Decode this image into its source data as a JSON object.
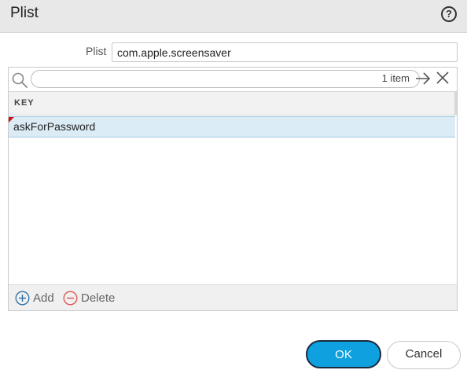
{
  "dialog": {
    "title": "Plist"
  },
  "icons": {
    "help": "help-circle-icon",
    "search": "search-icon",
    "apply": "arrow-right-icon",
    "clear": "close-icon",
    "add": "plus-circle-icon",
    "delete": "minus-circle-icon"
  },
  "plist": {
    "label": "Plist",
    "value": "com.apple.screensaver"
  },
  "filter": {
    "item_count": "1 item",
    "query": ""
  },
  "table": {
    "columns": [
      "KEY"
    ],
    "rows": [
      {
        "key": "askForPassword",
        "selected": true,
        "marker_color": "#c8161d"
      }
    ]
  },
  "footer": {
    "add_label": "Add",
    "delete_label": "Delete"
  },
  "buttons": {
    "ok_label": "OK",
    "cancel_label": "Cancel"
  },
  "colors": {
    "accent": "#0fa0e0",
    "selection": "#dcecf6",
    "delete": "#d9534f",
    "add": "#2b6fa6"
  }
}
